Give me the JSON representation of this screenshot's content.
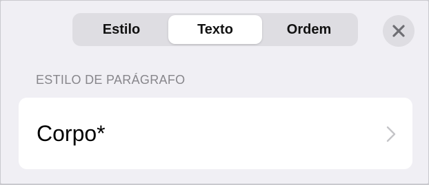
{
  "tabs": [
    {
      "label": "Estilo",
      "selected": false
    },
    {
      "label": "Texto",
      "selected": true
    },
    {
      "label": "Ordem",
      "selected": false
    }
  ],
  "close_icon": "close-x-icon",
  "section": {
    "header": "ESTILO DE PARÁGRAFO",
    "value": "Corpo*",
    "chevron_icon": "chevron-right-icon"
  },
  "colors": {
    "panel_background": "#f0eff4",
    "segment_background": "#dedde2",
    "selected_segment": "#ffffff",
    "secondary_text": "#87868b"
  }
}
